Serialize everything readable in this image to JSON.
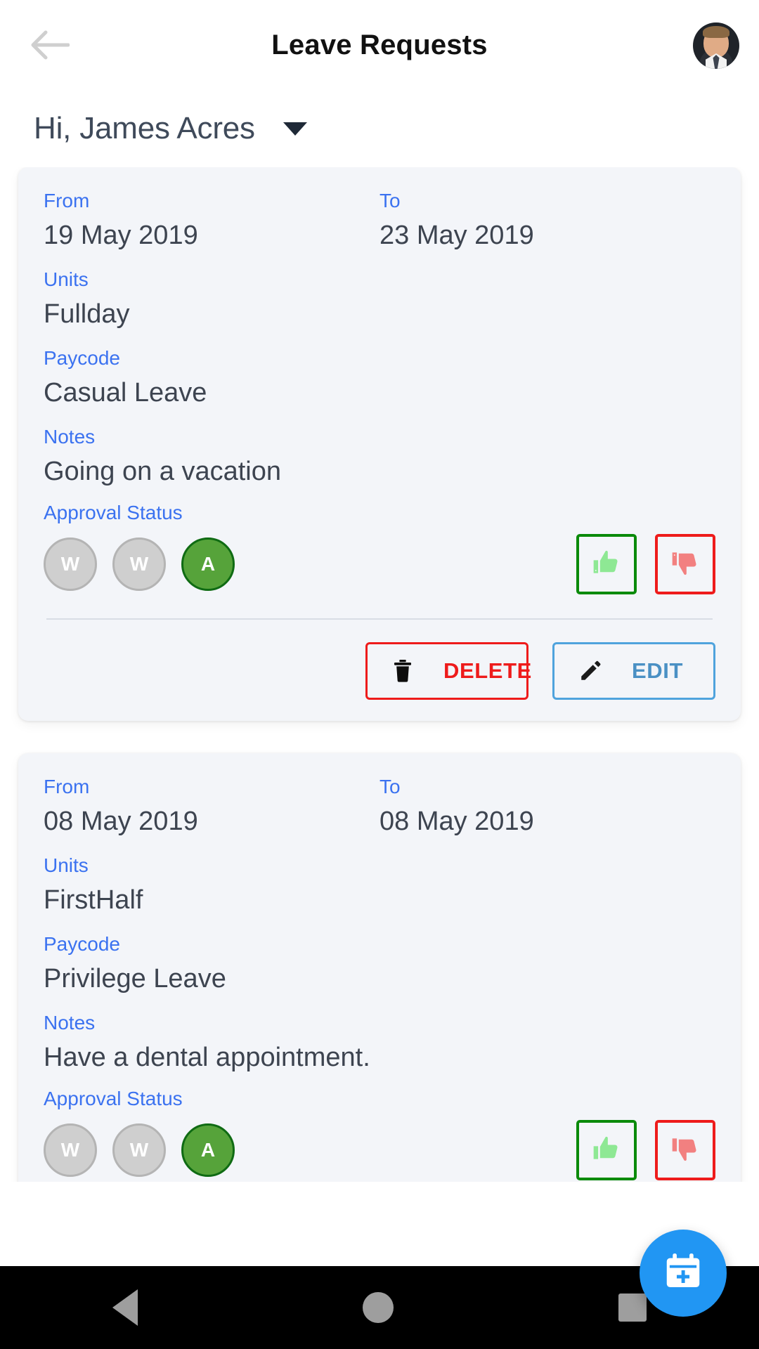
{
  "appbar": {
    "title": "Leave Requests",
    "back_icon": "arrow-left-icon",
    "avatar_alt": "user-avatar"
  },
  "greeting": {
    "text": "Hi, James Acres",
    "caret_icon": "chevron-down-icon"
  },
  "labels": {
    "from": "From",
    "to": "To",
    "units": "Units",
    "paycode": "Paycode",
    "notes": "Notes",
    "approval_status": "Approval Status"
  },
  "buttons": {
    "delete": "DELETE",
    "edit": "EDIT",
    "approve_icon": "thumbs-up-icon",
    "reject_icon": "thumbs-down-icon",
    "delete_icon": "trash-icon",
    "edit_icon": "pencil-icon",
    "fab_icon": "calendar-plus-icon"
  },
  "colors": {
    "label_blue": "#3b72f0",
    "value_gray": "#3d4450",
    "card_bg": "#f3f5f9",
    "approve_green": "#0a8a0a",
    "reject_red": "#ee1b1b",
    "edit_blue": "#4fa3dd",
    "fab_blue": "#2196f3",
    "status_waiting": "#cfcfcf",
    "status_approved": "#56a33a"
  },
  "requests": [
    {
      "from": "19 May 2019",
      "to": "23 May 2019",
      "units": "Fullday",
      "paycode": "Casual Leave",
      "notes": "Going on a vacation",
      "approval_status": [
        "W",
        "W",
        "A"
      ]
    },
    {
      "from": "08 May 2019",
      "to": "08 May 2019",
      "units": "FirstHalf",
      "paycode": "Privilege Leave",
      "notes": "Have a dental appointment.",
      "approval_status": [
        "W",
        "W",
        "A"
      ]
    }
  ],
  "navbar": {
    "back": "nav-back-icon",
    "home": "nav-home-icon",
    "recent": "nav-recent-icon"
  }
}
